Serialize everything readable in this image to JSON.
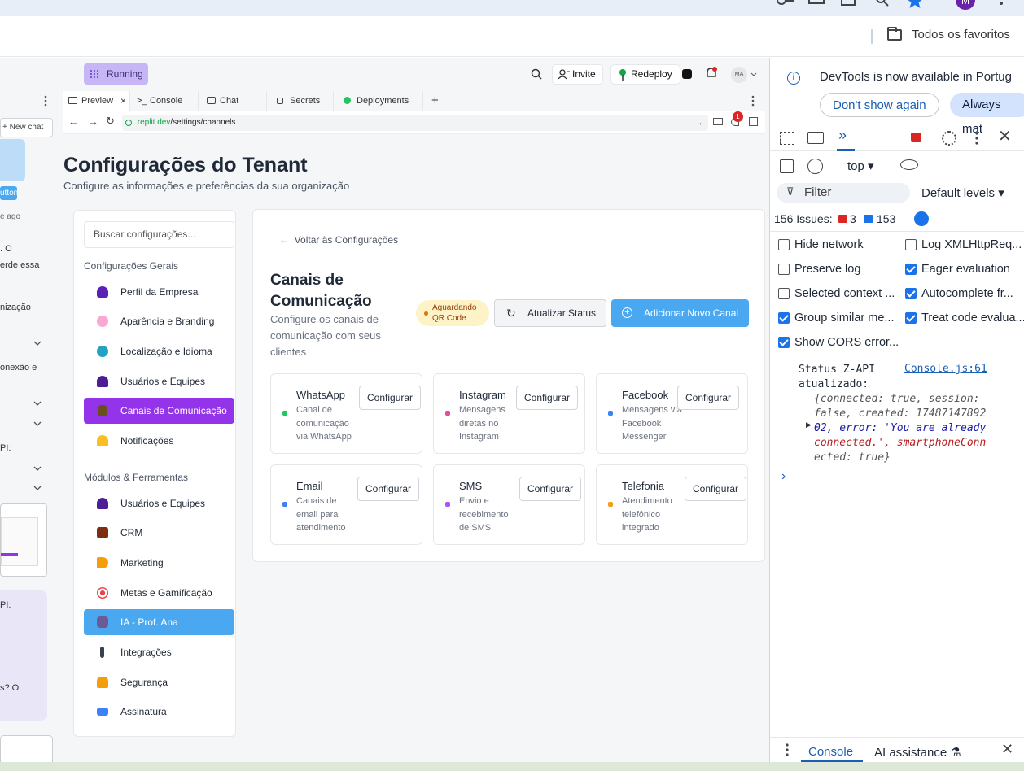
{
  "browser": {
    "bookmarks_label": "Todos os favoritos",
    "profile_initial": "M"
  },
  "replit": {
    "running_label": "Running",
    "invite_label": "Invite",
    "redeploy_label": "Redeploy",
    "avatar_initials": "MA",
    "new_chat_label": "+ New chat",
    "strip_texts": [
      "utton",
      "e ago",
      ". O",
      "erde essa",
      "nização",
      "onexão e",
      "PI:",
      "PI:",
      "s? O"
    ],
    "tabs": [
      "Preview",
      "Console",
      "Chat",
      "Secrets",
      "Deployments"
    ],
    "url_green": ".replit.dev",
    "url_path": "/settings/channels",
    "notif_count": "1"
  },
  "page": {
    "title": "Configurações do Tenant",
    "subtitle": "Configure as informações e preferências da sua organização",
    "search_placeholder": "Buscar configurações...",
    "section_general": "Configurações Gerais",
    "section_modules": "Módulos & Ferramentas",
    "general_items": [
      "Perfil da Empresa",
      "Aparência e Branding",
      "Localização e Idioma",
      "Usuários e Equipes",
      "Canais de Comunicação",
      "Notificações"
    ],
    "module_items": [
      "Usuários e Equipes",
      "CRM",
      "Marketing",
      "Metas e Gamificação",
      "IA - Prof. Ana",
      "Integrações",
      "Segurança",
      "Assinatura"
    ],
    "back_label": "Voltar às Configurações",
    "channels_title": "Canais de Comunicação",
    "channels_subtitle": "Configure os canais de comunicação com seus clientes",
    "qr_badge": "Aguardando QR Code",
    "refresh_button": "Atualizar Status",
    "add_button": "Adicionar Novo Canal",
    "configure_label": "Configurar",
    "channels": [
      {
        "name": "WhatsApp",
        "desc": "Canal de comunicação via WhatsApp",
        "color": "#22c55e"
      },
      {
        "name": "Instagram",
        "desc": "Mensagens diretas no Instagram",
        "color": "#ec4899"
      },
      {
        "name": "Facebook",
        "desc": "Mensagens via Facebook Messenger",
        "color": "#3b82f6"
      },
      {
        "name": "Email",
        "desc": "Canais de email para atendimento",
        "color": "#3b82f6"
      },
      {
        "name": "SMS",
        "desc": "Envio e recebimento de SMS",
        "color": "#a855f7"
      },
      {
        "name": "Telefonia",
        "desc": "Atendimento telefônico integrado",
        "color": "#f59e0b"
      }
    ]
  },
  "devtools": {
    "banner": "DevTools is now available in Portug",
    "dont_show": "Don't show again",
    "always_match": "Always mat",
    "context": "top",
    "filter_placeholder": "Filter",
    "levels": "Default levels",
    "issues_label": "156 Issues:",
    "issues_errors": "3",
    "issues_info": "153",
    "checkboxes": [
      {
        "label": "Hide network",
        "checked": false
      },
      {
        "label": "Log XMLHttpReq...",
        "checked": false
      },
      {
        "label": "Preserve log",
        "checked": false
      },
      {
        "label": "Eager evaluation",
        "checked": true
      },
      {
        "label": "Selected context ...",
        "checked": false
      },
      {
        "label": "Autocomplete fr...",
        "checked": true
      },
      {
        "label": "Group similar me...",
        "checked": true
      },
      {
        "label": "Treat code evalua...",
        "checked": true
      },
      {
        "label": "Show CORS error...",
        "checked": true
      }
    ],
    "log_message_1": "Status Z-API",
    "log_message_2": "atualizado:",
    "log_source": "Console.js:61",
    "log_obj_1": "{connected: true, session:",
    "log_obj_2": "false, created: 17487147892",
    "log_obj_3": "02, error: 'You are already",
    "log_obj_4": "connected.', smartphoneConn",
    "log_obj_5": "ected: true}",
    "bottom_console": "Console",
    "bottom_ai": "AI assistance"
  }
}
